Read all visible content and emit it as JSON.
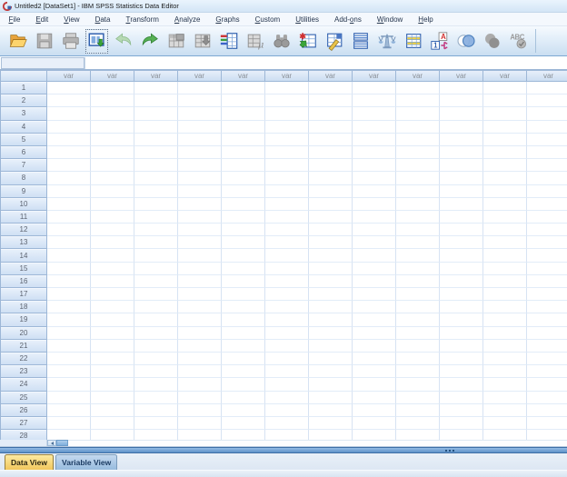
{
  "window": {
    "title": "Untitled2 [DataSet1] - IBM SPSS Statistics Data Editor"
  },
  "menu": {
    "items": [
      {
        "label": "File",
        "mnemonic": "F"
      },
      {
        "label": "Edit",
        "mnemonic": "E"
      },
      {
        "label": "View",
        "mnemonic": "V"
      },
      {
        "label": "Data",
        "mnemonic": "D"
      },
      {
        "label": "Transform",
        "mnemonic": "T"
      },
      {
        "label": "Analyze",
        "mnemonic": "A"
      },
      {
        "label": "Graphs",
        "mnemonic": "G"
      },
      {
        "label": "Custom",
        "mnemonic": "C"
      },
      {
        "label": "Utilities",
        "mnemonic": "U"
      },
      {
        "label": "Add-ons",
        "mnemonic": "o"
      },
      {
        "label": "Window",
        "mnemonic": "W"
      },
      {
        "label": "Help",
        "mnemonic": "H"
      }
    ]
  },
  "toolbar": {
    "buttons": [
      {
        "name": "open-data-document",
        "icon": "open-folder-icon",
        "enabled": true,
        "focused": false
      },
      {
        "name": "save-document",
        "icon": "save-disk-icon",
        "enabled": false,
        "focused": false
      },
      {
        "name": "print",
        "icon": "printer-icon",
        "enabled": false,
        "focused": false
      },
      {
        "name": "recall-recently-used-dialogs",
        "icon": "recall-dialogs-icon",
        "enabled": true,
        "focused": true
      },
      {
        "name": "undo",
        "icon": "undo-arrow-icon",
        "enabled": false,
        "focused": false
      },
      {
        "name": "redo",
        "icon": "redo-arrow-icon",
        "enabled": true,
        "focused": false
      },
      {
        "name": "go-to-case",
        "icon": "goto-case-icon",
        "enabled": false,
        "focused": false
      },
      {
        "name": "go-to-variable",
        "icon": "goto-variable-icon",
        "enabled": false,
        "focused": false
      },
      {
        "name": "variables",
        "icon": "variables-icon",
        "enabled": true,
        "focused": false
      },
      {
        "name": "run-descriptive-statistics",
        "icon": "descriptives-icon",
        "enabled": false,
        "focused": false
      },
      {
        "name": "find",
        "icon": "find-binoculars-icon",
        "enabled": false,
        "focused": false
      },
      {
        "name": "insert-cases",
        "icon": "insert-cases-icon",
        "enabled": true,
        "focused": false
      },
      {
        "name": "insert-variable",
        "icon": "insert-variable-icon",
        "enabled": true,
        "focused": false
      },
      {
        "name": "split-file",
        "icon": "split-file-icon",
        "enabled": true,
        "focused": false
      },
      {
        "name": "weight-cases",
        "icon": "weight-scale-icon",
        "enabled": true,
        "focused": false
      },
      {
        "name": "select-cases",
        "icon": "select-cases-icon",
        "enabled": true,
        "focused": false
      },
      {
        "name": "value-labels",
        "icon": "value-labels-icon",
        "enabled": true,
        "focused": false
      },
      {
        "name": "use-variable-sets",
        "icon": "variable-sets-icon",
        "enabled": true,
        "focused": false
      },
      {
        "name": "show-all-variables",
        "icon": "show-all-variables-icon",
        "enabled": false,
        "focused": false
      },
      {
        "name": "spell-check",
        "icon": "spell-check-icon",
        "enabled": false,
        "focused": false
      }
    ]
  },
  "cell_editor": {
    "reference_value": "",
    "editor_value": ""
  },
  "grid": {
    "column_header_label": "var",
    "column_count": 12,
    "row_numbers": [
      1,
      2,
      3,
      4,
      5,
      6,
      7,
      8,
      9,
      10,
      11,
      12,
      13,
      14,
      15,
      16,
      17,
      18,
      19,
      20,
      21,
      22,
      23,
      24,
      25,
      26,
      27,
      28
    ]
  },
  "tabs": [
    {
      "label": "Data View",
      "active": true
    },
    {
      "label": "Variable View",
      "active": false
    }
  ],
  "colors": {
    "accent_blue": "#5e92c8",
    "header_fill": "#d5e3f5",
    "active_tab": "#f1c75d",
    "inactive_tab": "#97bbde",
    "grid_line": "#d7e3f3"
  }
}
